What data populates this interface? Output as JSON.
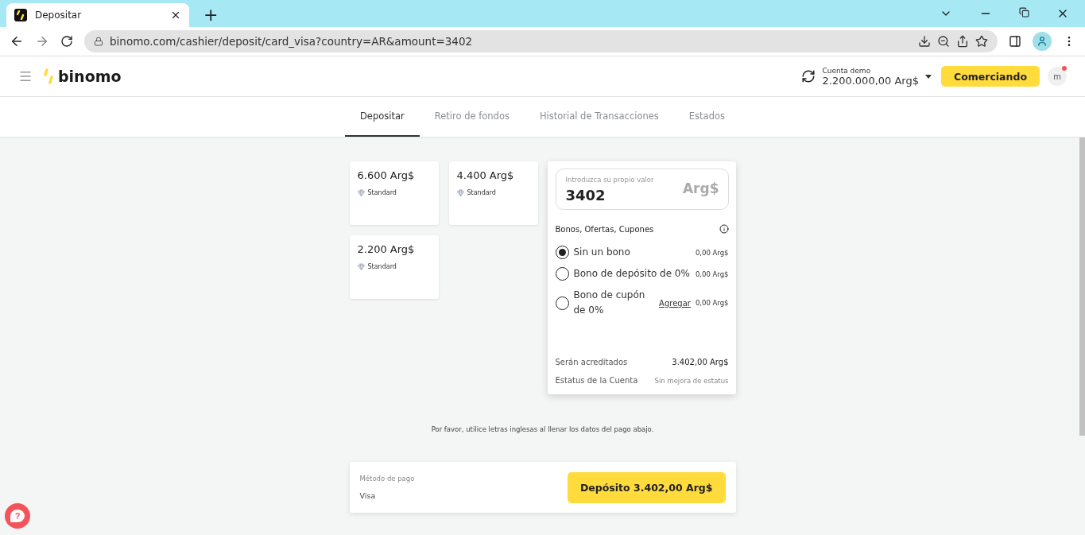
{
  "browser": {
    "tab_title": "Depositar",
    "new_tab": "+",
    "url": "binomo.com/cashier/deposit/card_visa?country=AR&amount=3402"
  },
  "header": {
    "logo": "binomo",
    "account_label": "Cuenta demo",
    "balance": "2.200.000,00 Arg$",
    "trade_button": "Comerciando",
    "avatar": "m",
    "has_notification": true
  },
  "tabs": [
    {
      "label": "Depositar",
      "selected": true
    },
    {
      "label": "Retiro de fondos",
      "selected": false
    },
    {
      "label": "Historial de Transacciones",
      "selected": false
    },
    {
      "label": "Estados",
      "selected": false
    }
  ],
  "presets": [
    {
      "amount": "6.600 Arg$",
      "tier": "Standard"
    },
    {
      "amount": "4.400 Arg$",
      "tier": "Standard"
    },
    {
      "amount": "2.200 Arg$",
      "tier": "Standard"
    }
  ],
  "amount_panel": {
    "placeholder": "Introduzca su propio valor",
    "value": "3402",
    "currency": "Arg$",
    "bonus_title": "Bonos, Ofertas, Cupones",
    "bonuses": [
      {
        "label": "Sin un bono",
        "amount": "0,00 Arg$",
        "selected": true
      },
      {
        "label": "Bono de depósito de 0%",
        "amount": "0,00 Arg$",
        "selected": false
      },
      {
        "label": "Bono de cupón de 0%",
        "link": "Agregar",
        "amount": "0,00 Arg$",
        "selected": false
      }
    ],
    "summary": [
      {
        "label": "Serán acreditados",
        "value": "3.402,00 Arg$",
        "kind": "strong"
      },
      {
        "label": "Estatus de la Cuenta",
        "value": "Sin mejora de estatus",
        "kind": "muted"
      }
    ]
  },
  "notice": "Por favor, utilice letras inglesas al llenar los datos del pago abajo.",
  "payment": {
    "method_label": "Método de pago",
    "method": "Visa",
    "button": "Depósito 3.402,00 Arg$"
  },
  "help": "?"
}
